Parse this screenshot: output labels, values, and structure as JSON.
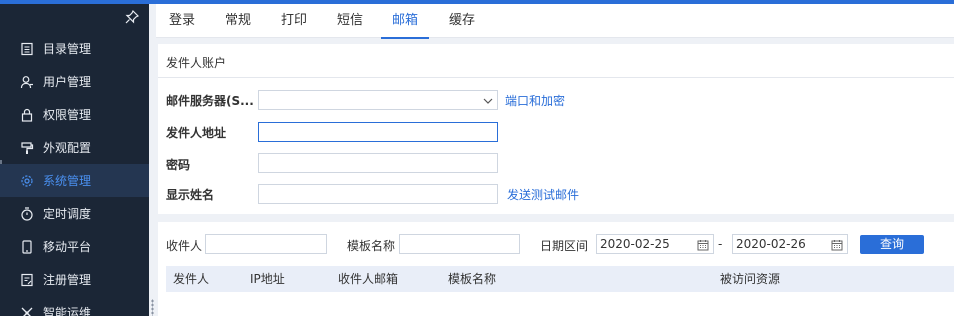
{
  "sidebar": {
    "items": [
      {
        "label": "目录管理",
        "icon": "catalog-icon"
      },
      {
        "label": "用户管理",
        "icon": "user-icon"
      },
      {
        "label": "权限管理",
        "icon": "lock-icon"
      },
      {
        "label": "外观配置",
        "icon": "appearance-icon"
      },
      {
        "label": "系统管理",
        "icon": "gear-icon"
      },
      {
        "label": "定时调度",
        "icon": "timer-icon"
      },
      {
        "label": "移动平台",
        "icon": "mobile-icon"
      },
      {
        "label": "注册管理",
        "icon": "register-icon"
      },
      {
        "label": "智能运维",
        "icon": "ops-icon"
      }
    ],
    "active_index": 4
  },
  "tabs": [
    "登录",
    "常规",
    "打印",
    "短信",
    "邮箱",
    "缓存"
  ],
  "active_tab": "邮箱",
  "sender": {
    "title": "发件人账户",
    "server_label": "邮件服务器(S...",
    "server_value": "",
    "port_link": "端口和加密",
    "address_label": "发件人地址",
    "address_value": "",
    "password_label": "密码",
    "password_value": "",
    "display_label": "显示姓名",
    "display_value": "",
    "test_link": "发送测试邮件"
  },
  "search": {
    "recipient_label": "收件人",
    "template_label": "模板名称",
    "date_label": "日期区间",
    "date_from": "2020-02-25",
    "date_sep": "-",
    "date_to": "2020-02-26",
    "query_button": "查询"
  },
  "table": {
    "headers": [
      "发件人",
      "IP地址",
      "收件人邮箱",
      "模板名称",
      "被访问资源"
    ]
  },
  "colors": {
    "accent": "#2a6ed8",
    "sidebar_bg": "#1b2636",
    "sidebar_active_bg": "#243651"
  }
}
